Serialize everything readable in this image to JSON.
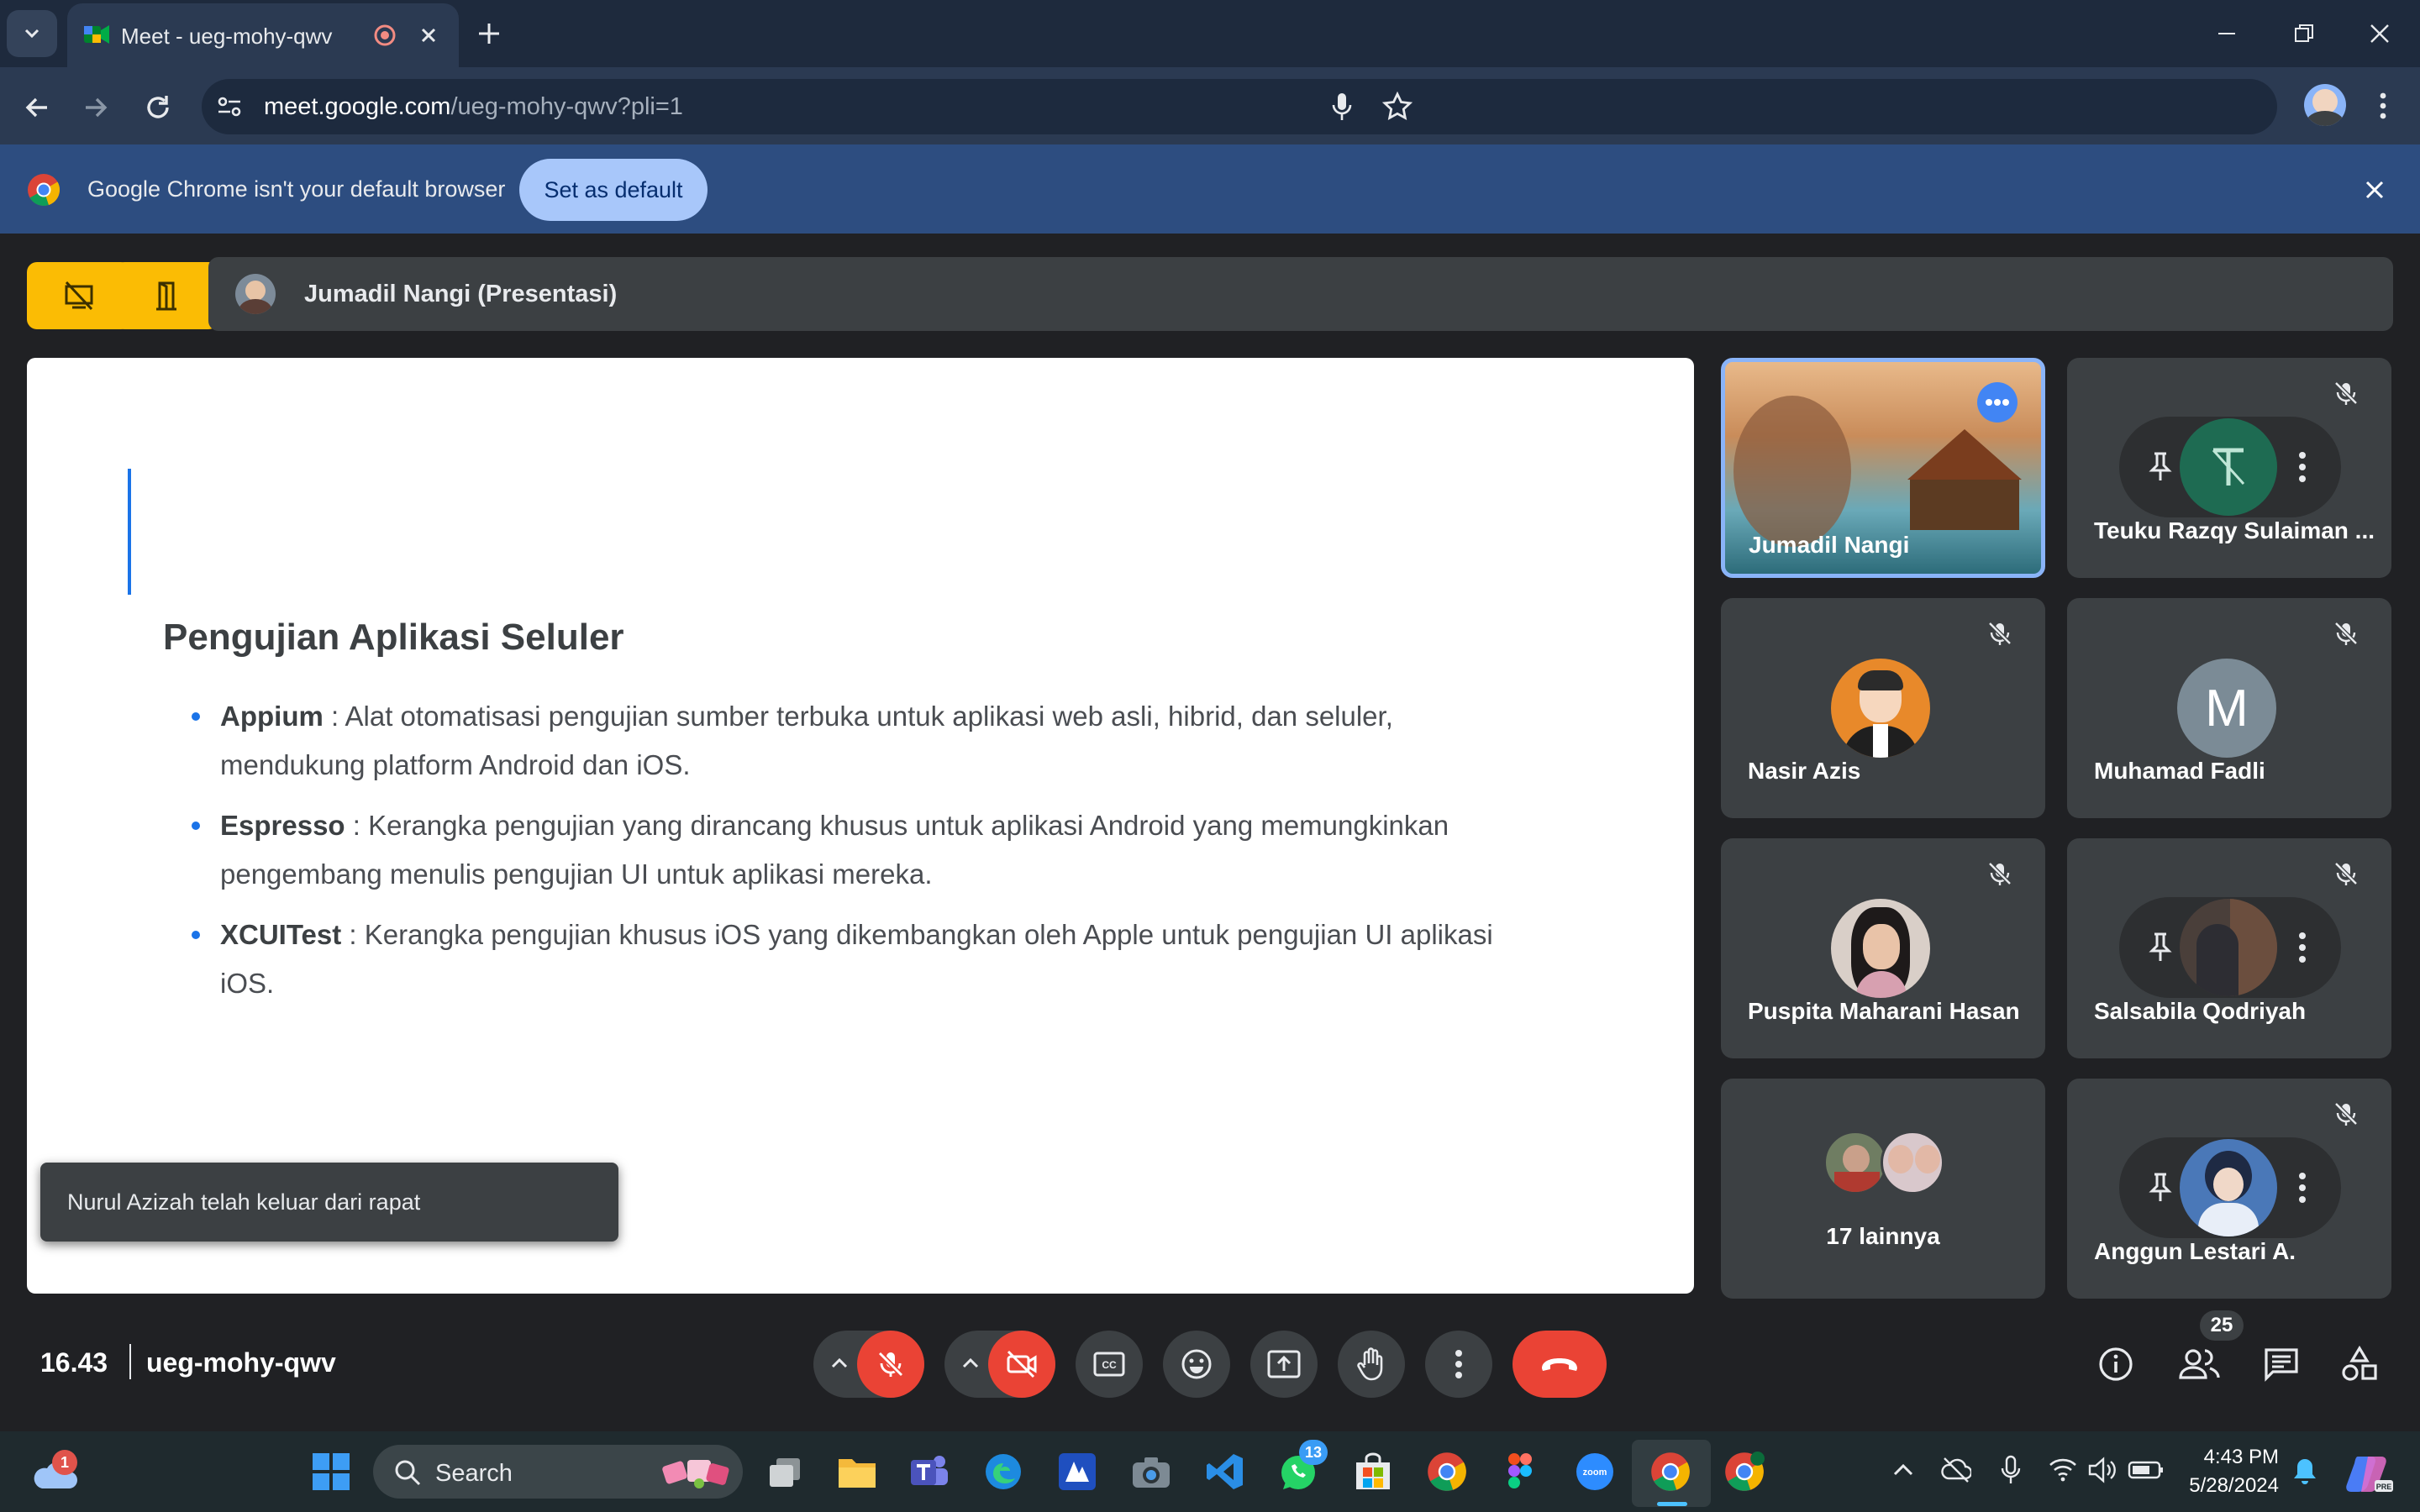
{
  "browser": {
    "tab_title": "Meet - ueg-mohy-qwv",
    "url_host": "meet.google.com",
    "url_path": "/ueg-mohy-qwv?pli=1",
    "infobar_text": "Google Chrome isn't your default browser",
    "infobar_button": "Set as default"
  },
  "meet": {
    "presenter_label": "Jumadil Nangi (Presentasi)",
    "slide": {
      "title": "Pengujian Aplikasi Seluler",
      "bullets": [
        {
          "term": "Appium",
          "line1": " : Alat otomatisasi pengujian sumber terbuka untuk aplikasi web asli, hibrid, dan seluler,",
          "line2": "mendukung platform Android dan iOS."
        },
        {
          "term": "Espresso",
          "line1": " : Kerangka pengujian yang dirancang khusus untuk aplikasi Android yang memungkinkan",
          "line2": "pengembang menulis pengujian UI untuk aplikasi mereka."
        },
        {
          "term": "XCUITest",
          "line1": " : Kerangka pengujian khusus iOS yang dikembangkan oleh Apple untuk pengujian UI aplikasi",
          "line2": "iOS."
        }
      ]
    },
    "toast": "Nurul Azizah telah keluar dari rapat",
    "participants": [
      {
        "name": "Jumadil Nangi"
      },
      {
        "name": "Teuku Razqy Sulaiman ..."
      },
      {
        "name": "Nasir Azis"
      },
      {
        "name": "Muhamad Fadli",
        "initial": "M"
      },
      {
        "name": "Puspita Maharani Hasan"
      },
      {
        "name": "Salsabila Qodriyah"
      },
      {
        "name": "17 lainnya"
      },
      {
        "name": "Anggun Lestari A."
      }
    ],
    "time": "16.43",
    "meeting_code": "ueg-mohy-qwv",
    "participant_count": "25"
  },
  "taskbar": {
    "weather_badge": "1",
    "search_label": "Search",
    "whatsapp_badge": "13",
    "time": "4:43 PM",
    "date": "5/28/2024"
  },
  "colors": {
    "accent_blue": "#1a73e8",
    "yellow": "#fbbc04",
    "red": "#ea4335",
    "meet_bg": "#202124"
  }
}
